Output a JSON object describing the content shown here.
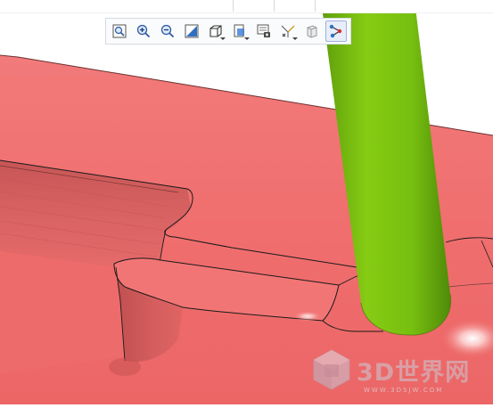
{
  "toolbar": {
    "buttons": [
      {
        "icon": "refit-icon",
        "active": false,
        "dropdown": false
      },
      {
        "icon": "zoom-in-icon",
        "active": false,
        "dropdown": false
      },
      {
        "icon": "zoom-out-icon",
        "active": false,
        "dropdown": false
      },
      {
        "icon": "repaint-icon",
        "active": false,
        "dropdown": false
      },
      {
        "icon": "display-style-icon",
        "active": false,
        "dropdown": true
      },
      {
        "icon": "saved-orientations-icon",
        "active": false,
        "dropdown": true
      },
      {
        "icon": "view-manager-icon",
        "active": false,
        "dropdown": false
      },
      {
        "icon": "datum-display-icon",
        "active": false,
        "dropdown": true
      },
      {
        "icon": "annotation-display-icon",
        "active": false,
        "dropdown": false
      },
      {
        "icon": "spin-center-icon",
        "active": true,
        "dropdown": false
      }
    ]
  },
  "watermark": {
    "text": "3D世界网",
    "url": "WWW.3DSJW.COM"
  },
  "colors": {
    "part_surface": "#f17070",
    "tool_body": "#7cc412",
    "edge": "#1a1a1a"
  }
}
